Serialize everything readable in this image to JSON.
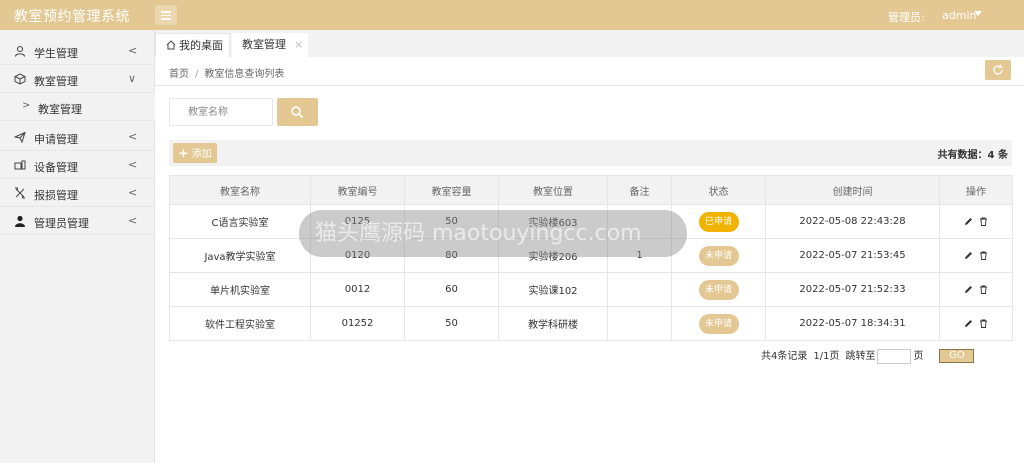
{
  "app": {
    "title": "教室预约管理系统"
  },
  "header": {
    "admin_label": "管理员:",
    "admin_name": "admin"
  },
  "sidebar": {
    "items": [
      {
        "label": "学生管理",
        "icon": "user-icon"
      },
      {
        "label": "教室管理",
        "icon": "cube-icon",
        "expanded": true
      },
      {
        "label": "教室管理",
        "icon": "chevron-right-icon",
        "sub": true
      },
      {
        "label": "申请管理",
        "icon": "send-icon"
      },
      {
        "label": "设备管理",
        "icon": "devices-icon"
      },
      {
        "label": "报损管理",
        "icon": "tools-icon"
      },
      {
        "label": "管理员管理",
        "icon": "person-icon"
      }
    ]
  },
  "tabs": {
    "home": "我的桌面",
    "current": "教室管理",
    "close": "×"
  },
  "breadcrumb": {
    "home": "首页",
    "sep": "/",
    "current": "教室信息查询列表"
  },
  "search": {
    "placeholder": "教室名称"
  },
  "toolbar": {
    "add_label": "添加",
    "total_label": "共有数据：4 条"
  },
  "table": {
    "headers": [
      "教室名称",
      "教室编号",
      "教室容量",
      "教室位置",
      "备注",
      "状态",
      "创建时间",
      "操作"
    ],
    "rows": [
      {
        "name": "C语言实验室",
        "code": "0125",
        "capacity": "50",
        "location": "实验楼603",
        "remark": "",
        "status": "已申请",
        "created": "2022-05-08 22:43:28"
      },
      {
        "name": "Java教学实验室",
        "code": "0120",
        "capacity": "80",
        "location": "实验楼206",
        "remark": "1",
        "status": "未申请",
        "created": "2022-05-07 21:53:45"
      },
      {
        "name": "单片机实验室",
        "code": "0012",
        "capacity": "60",
        "location": "实验课102",
        "remark": "",
        "status": "未申请",
        "created": "2022-05-07 21:52:33"
      },
      {
        "name": "软件工程实验室",
        "code": "01252",
        "capacity": "50",
        "location": "教学科研楼",
        "remark": "",
        "status": "未申请",
        "created": "2022-05-07 18:34:31"
      }
    ]
  },
  "pager": {
    "records": "共4条记录",
    "pages": "1/1页",
    "jump_label": "跳转至",
    "page_unit": "页",
    "go": "GO"
  },
  "watermark": {
    "text": "猫头鹰源码 maotouyingcc.com"
  },
  "colors": {
    "accent": "#e4c893",
    "status_applied": "#f0b400",
    "status_not_applied": "#e4c893"
  }
}
